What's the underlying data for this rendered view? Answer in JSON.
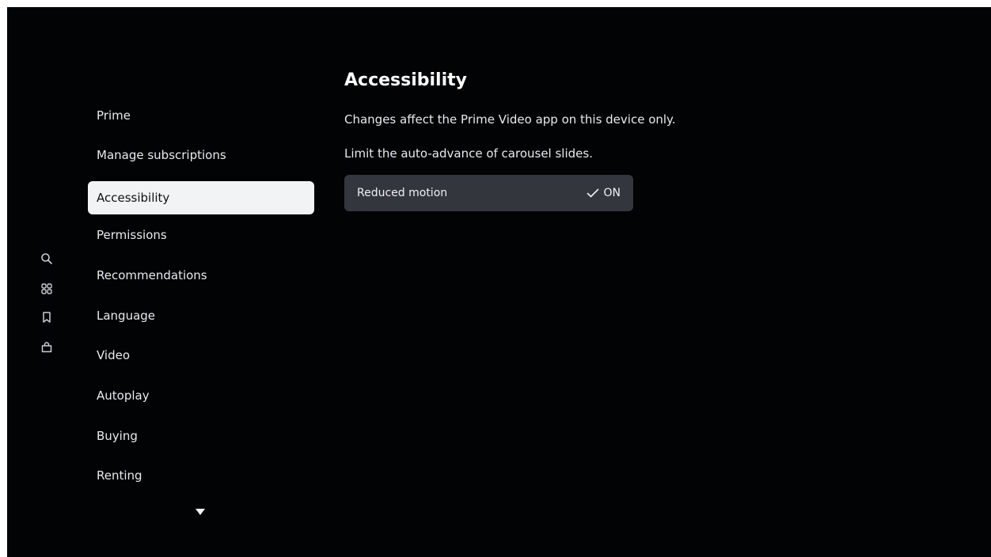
{
  "app": {
    "name": "Prime Video"
  },
  "rail": {
    "icons": [
      "search-icon",
      "categories-icon",
      "watchlist-icon",
      "store-icon"
    ]
  },
  "menu": {
    "items": [
      {
        "label": "Prime",
        "active": false
      },
      {
        "label": "Manage subscriptions",
        "active": false
      },
      {
        "label": "Accessibility",
        "active": true
      },
      {
        "label": "Permissions",
        "active": false
      },
      {
        "label": "Recommendations",
        "active": false
      },
      {
        "label": "Language",
        "active": false
      },
      {
        "label": "Video",
        "active": false
      },
      {
        "label": "Autoplay",
        "active": false
      },
      {
        "label": "Buying",
        "active": false
      },
      {
        "label": "Renting",
        "active": false
      }
    ],
    "more_indicator": "chevron-down-icon"
  },
  "content": {
    "title": "Accessibility",
    "description": "Changes affect the Prime Video app on this device only.",
    "setting_hint": "Limit the auto-advance of carousel slides.",
    "setting": {
      "label": "Reduced motion",
      "state_label": "ON",
      "state_icon": "checkmark-icon"
    }
  },
  "colors": {
    "background": "#020305",
    "active_item_bg": "#f2f3f5",
    "setting_row_bg": "#33373d",
    "text": "#e8eaed"
  }
}
